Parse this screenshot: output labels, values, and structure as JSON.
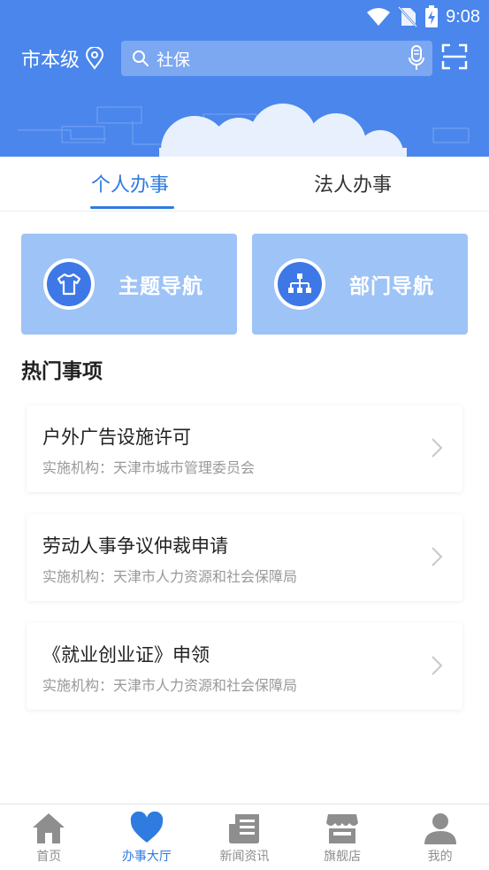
{
  "status_bar": {
    "time": "9:08"
  },
  "header": {
    "city": "市本级",
    "search_text": "社保"
  },
  "tabs": [
    {
      "label": "个人办事",
      "active": true
    },
    {
      "label": "法人办事",
      "active": false
    }
  ],
  "nav_cards": [
    {
      "label": "主题导航",
      "icon": "tshirt-icon"
    },
    {
      "label": "部门导航",
      "icon": "org-chart-icon"
    }
  ],
  "hot_section": {
    "title": "热门事项",
    "items": [
      {
        "title": "户外广告设施许可",
        "org": "实施机构：天津市城市管理委员会"
      },
      {
        "title": "劳动人事争议仲裁申请",
        "org": "实施机构：天津市人力资源和社会保障局"
      },
      {
        "title": "《就业创业证》申领",
        "org": "实施机构：天津市人力资源和社会保障局"
      }
    ]
  },
  "bottom_nav": [
    {
      "label": "首页",
      "icon": "home-icon",
      "active": false
    },
    {
      "label": "办事大厅",
      "icon": "heart-icon",
      "active": true
    },
    {
      "label": "新闻资讯",
      "icon": "news-icon",
      "active": false
    },
    {
      "label": "旗舰店",
      "icon": "store-icon",
      "active": false
    },
    {
      "label": "我的",
      "icon": "user-icon",
      "active": false
    }
  ],
  "colors": {
    "header_blue": "#4a86ec",
    "accent_blue": "#2f7be0",
    "nav_card_bg": "#9ec3f6"
  }
}
